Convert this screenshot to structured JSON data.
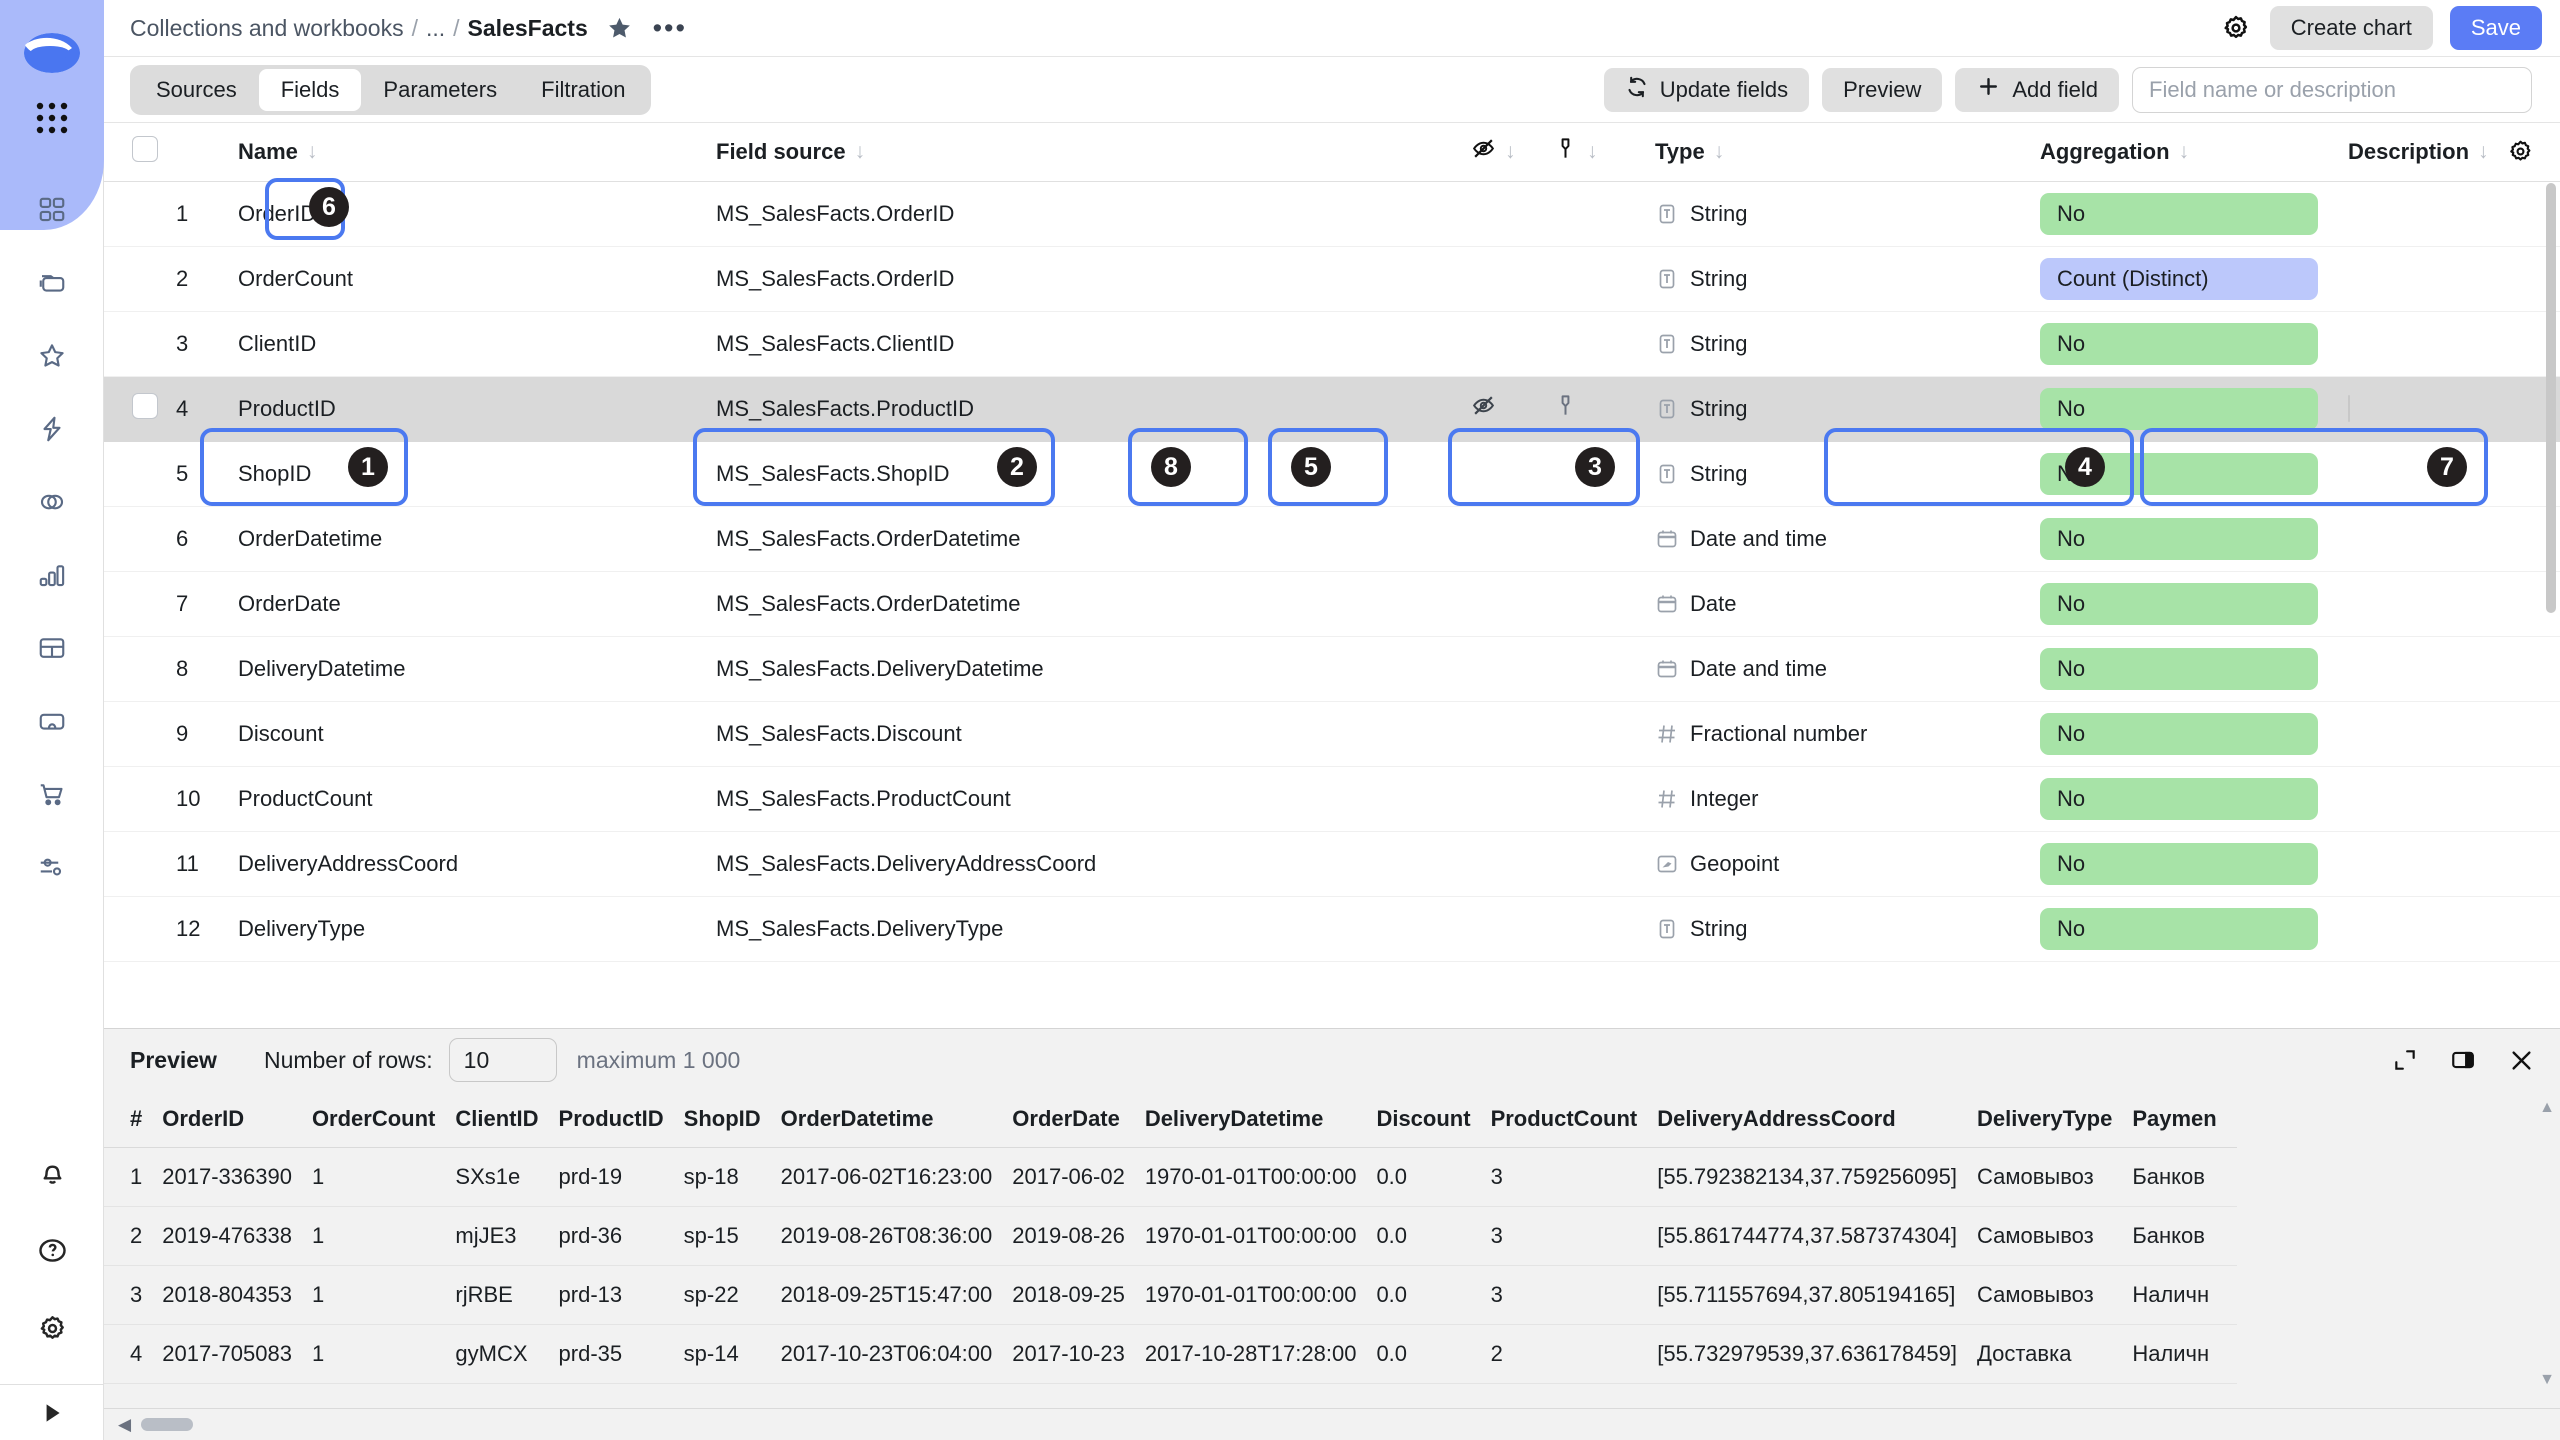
{
  "app": {
    "logo_icon": "datalens-logo-icon",
    "apps_grid_icon": "apps-grid-icon"
  },
  "sidebar": {
    "items": [
      {
        "icon": "dashboards-icon",
        "name": "sidebar-item-dashboards"
      },
      {
        "icon": "collections-icon",
        "name": "sidebar-item-collections"
      },
      {
        "icon": "favorites-star-icon",
        "name": "sidebar-item-favorites"
      },
      {
        "icon": "connections-bolt-icon",
        "name": "sidebar-item-connections"
      },
      {
        "icon": "datasets-circles-icon",
        "name": "sidebar-item-datasets"
      },
      {
        "icon": "charts-bar-icon",
        "name": "sidebar-item-charts"
      },
      {
        "icon": "table-grid-icon",
        "name": "sidebar-item-tables"
      },
      {
        "icon": "folder-cloud-icon",
        "name": "sidebar-item-storage"
      },
      {
        "icon": "cart-icon",
        "name": "sidebar-item-marketplace"
      },
      {
        "icon": "sliders-icon",
        "name": "sidebar-item-settings-params"
      }
    ],
    "bottom_items": [
      {
        "icon": "bell-icon",
        "name": "sidebar-item-notifications"
      },
      {
        "icon": "question-icon",
        "name": "sidebar-item-help"
      },
      {
        "icon": "gear-icon",
        "name": "sidebar-item-settings"
      }
    ],
    "collapse_icon": "expand-rail-icon"
  },
  "header": {
    "breadcrumb": {
      "root": "Collections and workbooks",
      "ellipsis": "...",
      "current": "SalesFacts",
      "separator": "/"
    },
    "star_icon": "star-filled-icon",
    "more_icon": "more-dots-icon",
    "gear_icon": "gear-icon",
    "create_chart_label": "Create chart",
    "save_label": "Save"
  },
  "toolbar": {
    "tabs": [
      {
        "label": "Sources",
        "active": false
      },
      {
        "label": "Fields",
        "active": true
      },
      {
        "label": "Parameters",
        "active": false
      },
      {
        "label": "Filtration",
        "active": false
      }
    ],
    "update_fields_label": "Update fields",
    "update_fields_icon": "refresh-icon",
    "preview_label": "Preview",
    "add_field_label": "Add field",
    "add_field_icon": "plus-icon",
    "search_placeholder": "Field name or description",
    "search_value": ""
  },
  "fields_table": {
    "columns": [
      {
        "key": "checkbox",
        "label": "",
        "sortable": false,
        "icon": "select-all-checkbox"
      },
      {
        "key": "num",
        "label": "",
        "sortable": false,
        "icon": ""
      },
      {
        "key": "name",
        "label": "Name",
        "sortable": true,
        "icon": ""
      },
      {
        "key": "source",
        "label": "Field source",
        "sortable": true,
        "icon": ""
      },
      {
        "key": "hidden",
        "label": "",
        "sortable": true,
        "icon": "eye-off-icon"
      },
      {
        "key": "key",
        "label": "",
        "sortable": true,
        "icon": "key-icon"
      },
      {
        "key": "type",
        "label": "Type",
        "sortable": true,
        "icon": ""
      },
      {
        "key": "aggregation",
        "label": "Aggregation",
        "sortable": true,
        "icon": ""
      },
      {
        "key": "description",
        "label": "Description",
        "sortable": true,
        "icon": ""
      }
    ],
    "settings_icon": "gear-icon",
    "sort_arrow": "↓",
    "rows": [
      {
        "num": "1",
        "name": "OrderID",
        "source": "MS_SalesFacts.OrderID",
        "type": "String",
        "type_icon": "text-type-icon",
        "aggregation": "No",
        "agg_color": "green",
        "description": "",
        "highlighted": false
      },
      {
        "num": "2",
        "name": "OrderCount",
        "source": "MS_SalesFacts.OrderID",
        "type": "String",
        "type_icon": "text-type-icon",
        "aggregation": "Count (Distinct)",
        "agg_color": "blue",
        "description": "",
        "highlighted": false
      },
      {
        "num": "3",
        "name": "ClientID",
        "source": "MS_SalesFacts.ClientID",
        "type": "String",
        "type_icon": "text-type-icon",
        "aggregation": "No",
        "agg_color": "green",
        "description": "",
        "highlighted": false
      },
      {
        "num": "4",
        "name": "ProductID",
        "source": "MS_SalesFacts.ProductID",
        "type": "String",
        "type_icon": "text-type-icon",
        "aggregation": "No",
        "agg_color": "green",
        "description": "",
        "highlighted": true
      },
      {
        "num": "5",
        "name": "ShopID",
        "source": "MS_SalesFacts.ShopID",
        "type": "String",
        "type_icon": "text-type-icon",
        "aggregation": "No",
        "agg_color": "green",
        "description": "",
        "highlighted": false
      },
      {
        "num": "6",
        "name": "OrderDatetime",
        "source": "MS_SalesFacts.OrderDatetime",
        "type": "Date and time",
        "type_icon": "calendar-icon",
        "aggregation": "No",
        "agg_color": "green",
        "description": "",
        "highlighted": false
      },
      {
        "num": "7",
        "name": "OrderDate",
        "source": "MS_SalesFacts.OrderDatetime",
        "type": "Date",
        "type_icon": "calendar-icon",
        "aggregation": "No",
        "agg_color": "green",
        "description": "",
        "highlighted": false
      },
      {
        "num": "8",
        "name": "DeliveryDatetime",
        "source": "MS_SalesFacts.DeliveryDatetime",
        "type": "Date and time",
        "type_icon": "calendar-icon",
        "aggregation": "No",
        "agg_color": "green",
        "description": "",
        "highlighted": false
      },
      {
        "num": "9",
        "name": "Discount",
        "source": "MS_SalesFacts.Discount",
        "type": "Fractional number",
        "type_icon": "hash-icon",
        "aggregation": "No",
        "agg_color": "green",
        "description": "",
        "highlighted": false
      },
      {
        "num": "10",
        "name": "ProductCount",
        "source": "MS_SalesFacts.ProductCount",
        "type": "Integer",
        "type_icon": "hash-icon",
        "aggregation": "No",
        "agg_color": "green",
        "description": "",
        "highlighted": false
      },
      {
        "num": "11",
        "name": "DeliveryAddressCoord",
        "source": "MS_SalesFacts.DeliveryAddressCoord",
        "type": "Geopoint",
        "type_icon": "geopoint-icon",
        "aggregation": "No",
        "agg_color": "green",
        "description": "",
        "highlighted": false
      },
      {
        "num": "12",
        "name": "DeliveryType",
        "source": "MS_SalesFacts.DeliveryType",
        "type": "String",
        "type_icon": "text-type-icon",
        "aggregation": "No",
        "agg_color": "green",
        "description": "",
        "highlighted": false
      }
    ]
  },
  "preview": {
    "title": "Preview",
    "rows_label": "Number of rows:",
    "rows_value": "10",
    "max_note": "maximum 1 000",
    "expand_icon": "expand-icon",
    "dock_icon": "dock-right-icon",
    "close_icon": "close-icon",
    "columns": [
      "#",
      "OrderID",
      "OrderCount",
      "ClientID",
      "ProductID",
      "ShopID",
      "OrderDatetime",
      "OrderDate",
      "DeliveryDatetime",
      "Discount",
      "ProductCount",
      "DeliveryAddressCoord",
      "DeliveryType",
      "Paymen"
    ],
    "rows": [
      [
        "1",
        "2017-336390",
        "1",
        "SXs1e",
        "prd-19",
        "sp-18",
        "2017-06-02T16:23:00",
        "2017-06-02",
        "1970-01-01T00:00:00",
        "0.0",
        "3",
        "[55.792382134,37.759256095]",
        "Самовывоз",
        "Банков"
      ],
      [
        "2",
        "2019-476338",
        "1",
        "mjJE3",
        "prd-36",
        "sp-15",
        "2019-08-26T08:36:00",
        "2019-08-26",
        "1970-01-01T00:00:00",
        "0.0",
        "3",
        "[55.861744774,37.587374304]",
        "Самовывоз",
        "Банков"
      ],
      [
        "3",
        "2018-804353",
        "1",
        "rjRBE",
        "prd-13",
        "sp-22",
        "2018-09-25T15:47:00",
        "2018-09-25",
        "1970-01-01T00:00:00",
        "0.0",
        "3",
        "[55.711557694,37.805194165]",
        "Самовывоз",
        "Наличн"
      ],
      [
        "4",
        "2017-705083",
        "1",
        "gyMCX",
        "prd-35",
        "sp-14",
        "2017-10-23T06:04:00",
        "2017-10-23",
        "2017-10-28T17:28:00",
        "0.0",
        "2",
        "[55.732979539,37.636178459]",
        "Доставка",
        "Наличн"
      ]
    ]
  },
  "annotations": {
    "accent_color": "#4b79f0",
    "badge_color": "#231f1f",
    "markers": [
      {
        "label": "1",
        "target": "field-name-cell"
      },
      {
        "label": "2",
        "target": "field-source-cell"
      },
      {
        "label": "3",
        "target": "field-type-cell"
      },
      {
        "label": "4",
        "target": "field-aggregation-cell"
      },
      {
        "label": "5",
        "target": "field-key-cell"
      },
      {
        "label": "6",
        "target": "name-column-sort"
      },
      {
        "label": "7",
        "target": "field-description-cell"
      },
      {
        "label": "8",
        "target": "field-hidden-cell"
      }
    ]
  }
}
